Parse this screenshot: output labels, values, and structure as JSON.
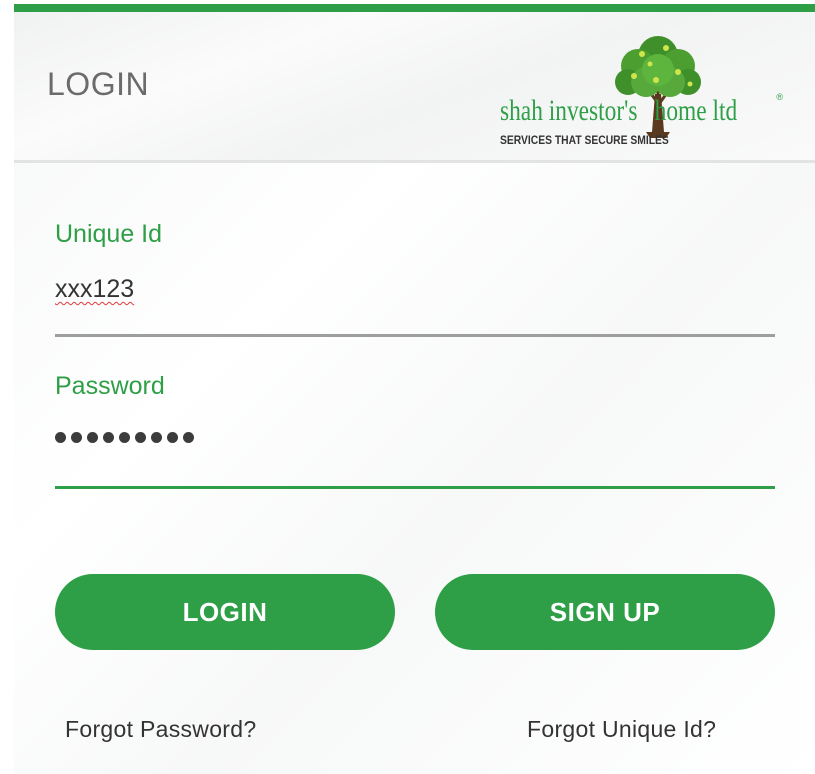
{
  "header": {
    "title": "LOGIN",
    "logo": {
      "wordmark_left": "shah investor's",
      "wordmark_right": "home ltd",
      "registered": "®",
      "tagline": "SERVICES THAT SECURE SMILES",
      "icon": "tree-icon"
    }
  },
  "form": {
    "unique_id": {
      "label": "Unique Id",
      "value": "xxx123"
    },
    "password": {
      "label": "Password",
      "masked_length": 9
    }
  },
  "buttons": {
    "login": "LOGIN",
    "signup": "SIGN UP"
  },
  "links": {
    "forgot_password": "Forgot Password?",
    "forgot_unique_id": "Forgot Unique Id?"
  },
  "colors": {
    "accent": "#2e9f47",
    "text": "#333333",
    "title": "#6b6b6b",
    "inactive_underline": "#9e9e9e"
  }
}
